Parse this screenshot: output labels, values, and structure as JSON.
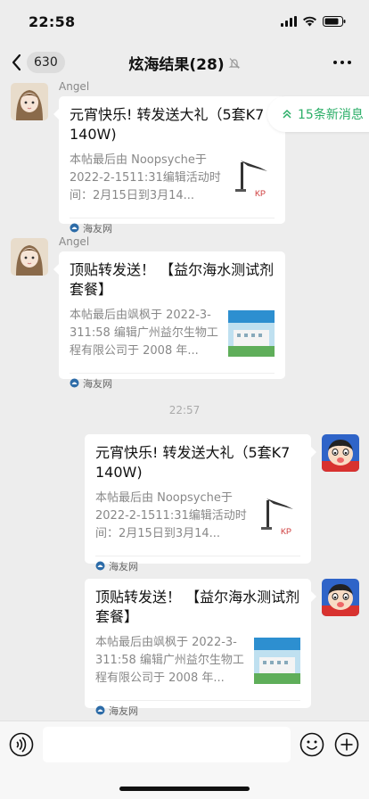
{
  "status": {
    "time": "22:58"
  },
  "nav": {
    "back_count": "630",
    "title": "炫海结果(28)"
  },
  "new_messages": {
    "label": "15条新消息"
  },
  "messages": [
    {
      "sender": "Angel",
      "title": "元宵快乐! 转发送大礼（5套K7  140W)",
      "desc": "本帖最后由 Noopsyche于 2022-2-1511:31编辑活动时间：2月15日到3月14...",
      "source": "海友网"
    },
    {
      "sender": "Angel",
      "title": "顶贴转发送！ 【益尔海水测试剂套餐】",
      "desc": "本帖最后由飒枫于 2022-3-311:58 编辑广州益尔生物工程有限公司于 2008 年...",
      "source": "海友网"
    },
    {
      "title": "元宵快乐! 转发送大礼（5套K7  140W)",
      "desc": "本帖最后由 Noopsyche于 2022-2-1511:31编辑活动时间：2月15日到3月14...",
      "source": "海友网"
    },
    {
      "title": "顶贴转发送！ 【益尔海水测试剂套餐】",
      "desc": "本帖最后由飒枫于 2022-3-311:58 编辑广州益尔生物工程有限公司于 2008 年...",
      "source": "海友网"
    }
  ],
  "timestamp": "22:57",
  "colors": {
    "accent_green": "#2aae67",
    "background": "#ededed"
  }
}
